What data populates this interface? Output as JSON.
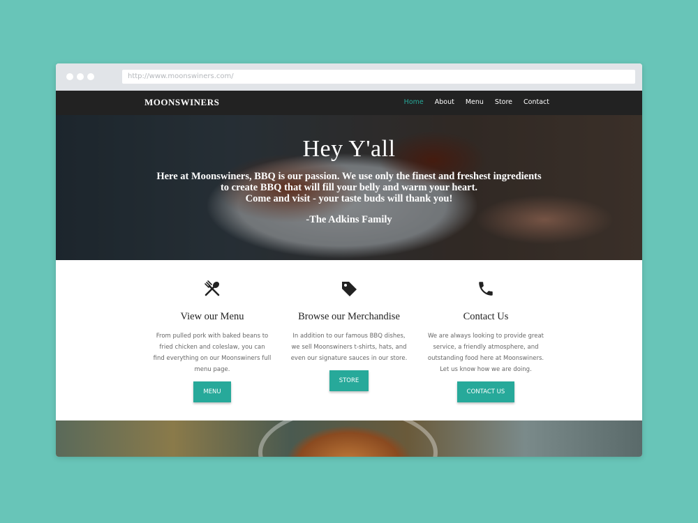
{
  "browser": {
    "url": "http://www.moonswiners.com/"
  },
  "nav": {
    "brand": "MOONSWINERS",
    "items": [
      {
        "label": "Home",
        "active": true
      },
      {
        "label": "About",
        "active": false
      },
      {
        "label": "Menu",
        "active": false
      },
      {
        "label": "Store",
        "active": false
      },
      {
        "label": "Contact",
        "active": false
      }
    ]
  },
  "hero": {
    "title": "Hey Y'all",
    "intro": "Here at Moonswiners, BBQ is our passion. We use only the finest and freshest ingredients\nto create BBQ that will fill your belly and warm your heart.\nCome and visit - your taste buds will thank you!",
    "signature": "-The Adkins Family"
  },
  "features": [
    {
      "icon": "utensils-icon",
      "title": "View our Menu",
      "text": "From pulled pork with baked beans to fried chicken and coleslaw, you can find everything on our Moonswiners full menu page.",
      "button": "MENU"
    },
    {
      "icon": "tag-icon",
      "title": "Browse our Merchandise",
      "text": "In addition to our famous BBQ dishes, we sell Moonswiners t-shirts, hats, and even our signature sauces in our store.",
      "button": "STORE"
    },
    {
      "icon": "phone-icon",
      "title": "Contact Us",
      "text": "We are always looking to provide great service, a friendly atmosphere, and outstanding food here at Moonswiners. Let us know how we are doing.",
      "button": "CONTACT US"
    }
  ],
  "colors": {
    "background": "#68c5b8",
    "accent": "#27a99a",
    "navbar": "#222222"
  }
}
